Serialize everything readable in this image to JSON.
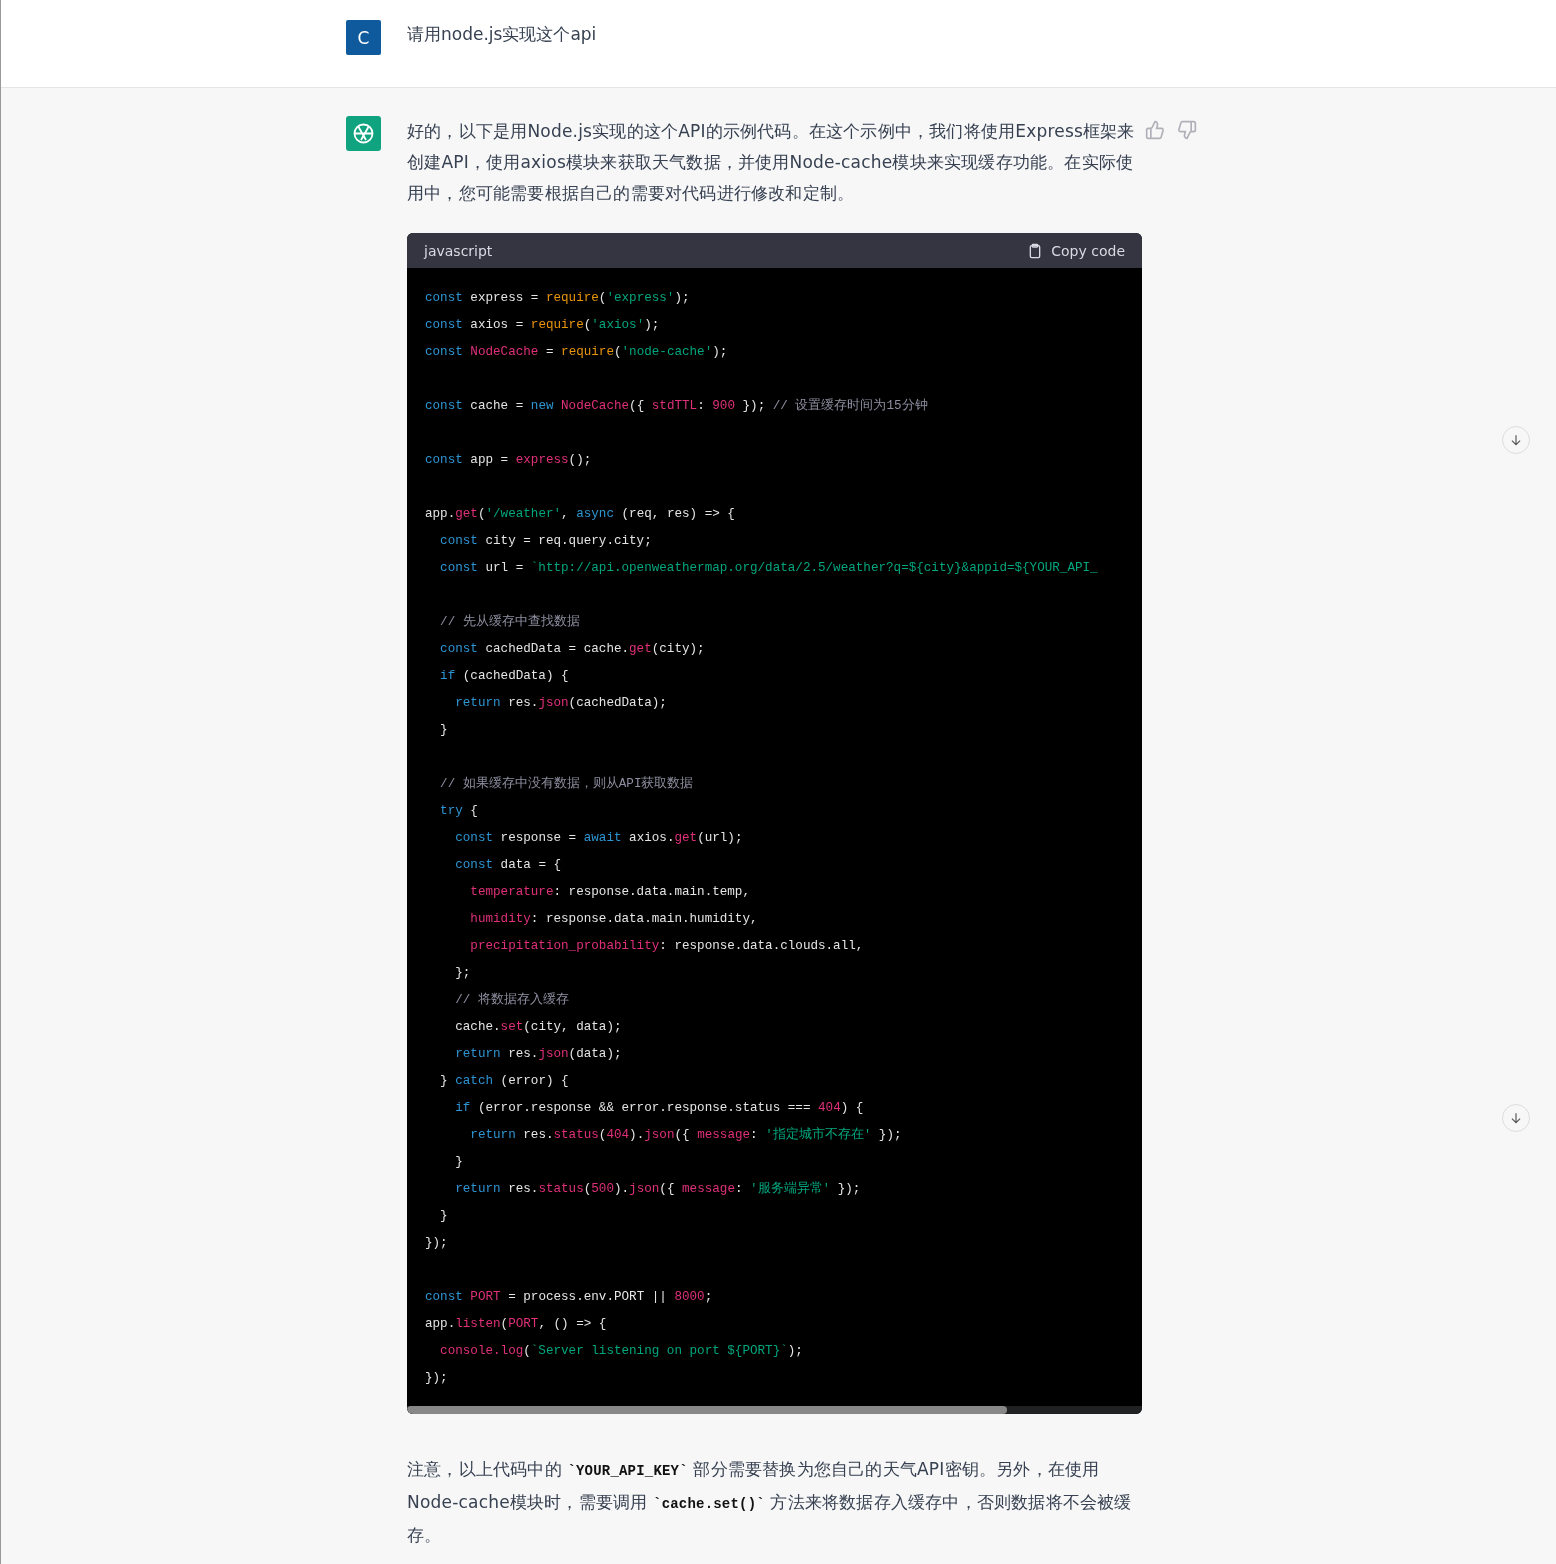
{
  "user_message": {
    "avatar_letter": "C",
    "text": "请用node.js实现这个api"
  },
  "assistant_message": {
    "intro": "好的，以下是用Node.js实现的这个API的示例代码。在这个示例中，我们将使用Express框架来创建API，使用axios模块来获取天气数据，并使用Node-cache模块来实现缓存功能。在实际使用中，您可能需要根据自己的需要对代码进行修改和定制。",
    "code_block": {
      "language": "javascript",
      "copy_label": "Copy code",
      "blocks": [
        [
          [
            {
              "text": "const",
              "kind": "kw"
            },
            {
              "text": " express = ",
              "kind": "pl"
            },
            {
              "text": "require",
              "kind": "req"
            },
            {
              "text": "(",
              "kind": "pl"
            },
            {
              "text": "'express'",
              "kind": "str"
            },
            {
              "text": ");",
              "kind": "pl"
            }
          ],
          [
            {
              "text": "const",
              "kind": "kw"
            },
            {
              "text": " axios = ",
              "kind": "pl"
            },
            {
              "text": "require",
              "kind": "req"
            },
            {
              "text": "(",
              "kind": "pl"
            },
            {
              "text": "'axios'",
              "kind": "str"
            },
            {
              "text": ");",
              "kind": "pl"
            }
          ],
          [
            {
              "text": "const ",
              "kind": "kw"
            },
            {
              "text": "NodeCache",
              "kind": "fn"
            },
            {
              "text": " = ",
              "kind": "pl"
            },
            {
              "text": "require",
              "kind": "req"
            },
            {
              "text": "(",
              "kind": "pl"
            },
            {
              "text": "'node-cache'",
              "kind": "str"
            },
            {
              "text": ");",
              "kind": "pl"
            }
          ]
        ],
        [
          [
            {
              "text": "const",
              "kind": "kw"
            },
            {
              "text": " cache = ",
              "kind": "pl"
            },
            {
              "text": "new ",
              "kind": "kw"
            },
            {
              "text": "NodeCache",
              "kind": "fn"
            },
            {
              "text": "({ ",
              "kind": "pl"
            },
            {
              "text": "stdTTL",
              "kind": "prop"
            },
            {
              "text": ": ",
              "kind": "pl"
            },
            {
              "text": "900",
              "kind": "num"
            },
            {
              "text": " }); ",
              "kind": "pl"
            },
            {
              "text": "// 设置缓存时间为15分钟",
              "kind": "cm"
            }
          ]
        ],
        [
          [
            {
              "text": "const",
              "kind": "kw"
            },
            {
              "text": " app = ",
              "kind": "pl"
            },
            {
              "text": "express",
              "kind": "fn"
            },
            {
              "text": "();",
              "kind": "pl"
            }
          ]
        ],
        [
          [
            {
              "text": "app.",
              "kind": "pl"
            },
            {
              "text": "get",
              "kind": "fn"
            },
            {
              "text": "(",
              "kind": "pl"
            },
            {
              "text": "'/weather'",
              "kind": "str"
            },
            {
              "text": ", ",
              "kind": "pl"
            },
            {
              "text": "async",
              "kind": "kw"
            },
            {
              "text": " (req, res) => {",
              "kind": "pl"
            }
          ],
          [
            {
              "text": "  const",
              "kind": "kw"
            },
            {
              "text": " city = req.query.city;",
              "kind": "pl"
            }
          ],
          [
            {
              "text": "  const",
              "kind": "kw"
            },
            {
              "text": " url = ",
              "kind": "pl"
            },
            {
              "text": "`http://api.openweathermap.org/data/2.5/weather?q=${city}&appid=${YOUR_API_",
              "kind": "str"
            }
          ]
        ],
        [
          [
            {
              "text": "  // 先从缓存中查找数据",
              "kind": "cm"
            }
          ],
          [
            {
              "text": "  const",
              "kind": "kw"
            },
            {
              "text": " cachedData = cache.",
              "kind": "pl"
            },
            {
              "text": "get",
              "kind": "fn"
            },
            {
              "text": "(city);",
              "kind": "pl"
            }
          ],
          [
            {
              "text": "  if",
              "kind": "kw"
            },
            {
              "text": " (cachedData) {",
              "kind": "pl"
            }
          ],
          [
            {
              "text": "    return",
              "kind": "kw"
            },
            {
              "text": " res.",
              "kind": "pl"
            },
            {
              "text": "json",
              "kind": "fn"
            },
            {
              "text": "(cachedData);",
              "kind": "pl"
            }
          ],
          [
            {
              "text": "  }",
              "kind": "pl"
            }
          ]
        ],
        [
          [
            {
              "text": "  // 如果缓存中没有数据，则从API获取数据",
              "kind": "cm"
            }
          ],
          [
            {
              "text": "  try",
              "kind": "kw"
            },
            {
              "text": " {",
              "kind": "pl"
            }
          ],
          [
            {
              "text": "    const",
              "kind": "kw"
            },
            {
              "text": " response = ",
              "kind": "pl"
            },
            {
              "text": "await",
              "kind": "kw"
            },
            {
              "text": " axios.",
              "kind": "pl"
            },
            {
              "text": "get",
              "kind": "fn"
            },
            {
              "text": "(url);",
              "kind": "pl"
            }
          ],
          [
            {
              "text": "    const",
              "kind": "kw"
            },
            {
              "text": " data = {",
              "kind": "pl"
            }
          ],
          [
            {
              "text": "      temperature",
              "kind": "prop"
            },
            {
              "text": ": response.data.main.temp,",
              "kind": "pl"
            }
          ],
          [
            {
              "text": "      humidity",
              "kind": "prop"
            },
            {
              "text": ": response.data.main.humidity,",
              "kind": "pl"
            }
          ],
          [
            {
              "text": "      precipitation_probability",
              "kind": "prop"
            },
            {
              "text": ": response.data.clouds.all,",
              "kind": "pl"
            }
          ],
          [
            {
              "text": "    };",
              "kind": "pl"
            }
          ],
          [
            {
              "text": "    // 将数据存入缓存",
              "kind": "cm"
            }
          ],
          [
            {
              "text": "    cache.",
              "kind": "pl"
            },
            {
              "text": "set",
              "kind": "fn"
            },
            {
              "text": "(city, data);",
              "kind": "pl"
            }
          ],
          [
            {
              "text": "    return",
              "kind": "kw"
            },
            {
              "text": " res.",
              "kind": "pl"
            },
            {
              "text": "json",
              "kind": "fn"
            },
            {
              "text": "(data);",
              "kind": "pl"
            }
          ],
          [
            {
              "text": "  } ",
              "kind": "pl"
            },
            {
              "text": "catch",
              "kind": "kw"
            },
            {
              "text": " (error) {",
              "kind": "pl"
            }
          ],
          [
            {
              "text": "    if",
              "kind": "kw"
            },
            {
              "text": " (error.response && error.response.status === ",
              "kind": "pl"
            },
            {
              "text": "404",
              "kind": "num"
            },
            {
              "text": ") {",
              "kind": "pl"
            }
          ],
          [
            {
              "text": "      return",
              "kind": "kw"
            },
            {
              "text": " res.",
              "kind": "pl"
            },
            {
              "text": "status",
              "kind": "fn"
            },
            {
              "text": "(",
              "kind": "pl"
            },
            {
              "text": "404",
              "kind": "num"
            },
            {
              "text": ").",
              "kind": "pl"
            },
            {
              "text": "json",
              "kind": "fn"
            },
            {
              "text": "({ ",
              "kind": "pl"
            },
            {
              "text": "message",
              "kind": "prop"
            },
            {
              "text": ": ",
              "kind": "pl"
            },
            {
              "text": "'指定城市不存在'",
              "kind": "str"
            },
            {
              "text": " });",
              "kind": "pl"
            }
          ],
          [
            {
              "text": "    }",
              "kind": "pl"
            }
          ],
          [
            {
              "text": "    return",
              "kind": "kw"
            },
            {
              "text": " res.",
              "kind": "pl"
            },
            {
              "text": "status",
              "kind": "fn"
            },
            {
              "text": "(",
              "kind": "pl"
            },
            {
              "text": "500",
              "kind": "num"
            },
            {
              "text": ").",
              "kind": "pl"
            },
            {
              "text": "json",
              "kind": "fn"
            },
            {
              "text": "({ ",
              "kind": "pl"
            },
            {
              "text": "message",
              "kind": "prop"
            },
            {
              "text": ": ",
              "kind": "pl"
            },
            {
              "text": "'服务端异常'",
              "kind": "str"
            },
            {
              "text": " });",
              "kind": "pl"
            }
          ],
          [
            {
              "text": "  }",
              "kind": "pl"
            }
          ],
          [
            {
              "text": "});",
              "kind": "pl"
            }
          ]
        ],
        [
          [
            {
              "text": "const ",
              "kind": "kw"
            },
            {
              "text": "PORT",
              "kind": "fn"
            },
            {
              "text": " = process.env.PORT || ",
              "kind": "pl"
            },
            {
              "text": "8000",
              "kind": "num"
            },
            {
              "text": ";",
              "kind": "pl"
            }
          ],
          [
            {
              "text": "app.",
              "kind": "pl"
            },
            {
              "text": "listen",
              "kind": "fn"
            },
            {
              "text": "(",
              "kind": "pl"
            },
            {
              "text": "PORT",
              "kind": "fn"
            },
            {
              "text": ", () => {",
              "kind": "pl"
            }
          ],
          [
            {
              "text": "  console.log",
              "kind": "fn"
            },
            {
              "text": "(",
              "kind": "pl"
            },
            {
              "text": "`Server listening on port ${PORT}`",
              "kind": "str"
            },
            {
              "text": ");",
              "kind": "pl"
            }
          ],
          [
            {
              "text": "});",
              "kind": "pl"
            }
          ]
        ]
      ]
    },
    "note": [
      {
        "text": "注意，以上代码中的 ",
        "kind": "text"
      },
      {
        "text": "`YOUR_API_KEY`",
        "kind": "code"
      },
      {
        "text": " 部分需要替换为您自己的天气API密钥。另外，在使用Node-cache模块时，需要调用 ",
        "kind": "text"
      },
      {
        "text": "`cache.set()`",
        "kind": "code"
      },
      {
        "text": " 方法来将数据存入缓存中，否则数据将不会被缓存。",
        "kind": "text"
      }
    ]
  }
}
